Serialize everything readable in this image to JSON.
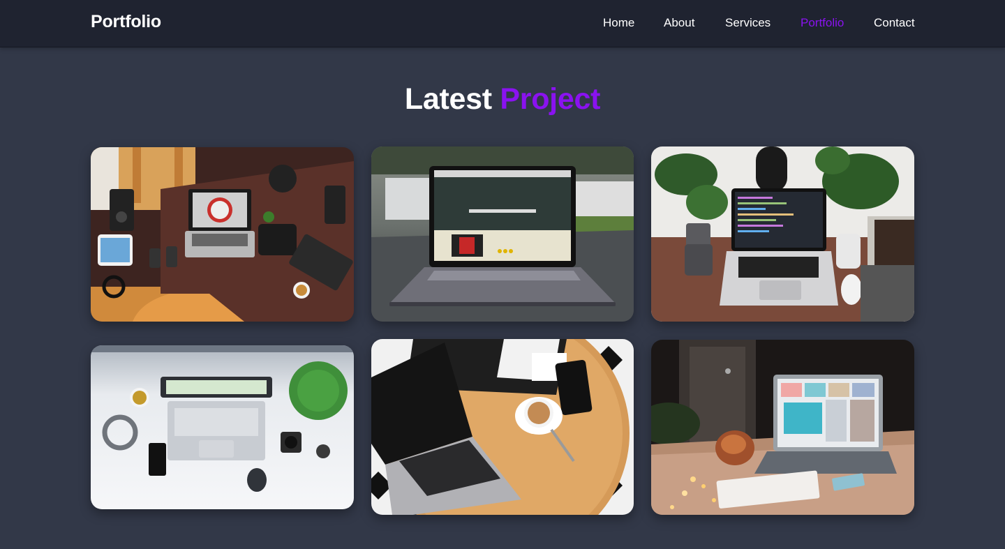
{
  "nav": {
    "brand": "Portfolio",
    "links": [
      {
        "label": "Home",
        "active": false
      },
      {
        "label": "About",
        "active": false
      },
      {
        "label": "Services",
        "active": false
      },
      {
        "label": "Portfolio",
        "active": true
      },
      {
        "label": "Contact",
        "active": false
      }
    ]
  },
  "section": {
    "title_main": "Latest",
    "title_accent": "Project"
  },
  "colors": {
    "page_background": "#323848",
    "navbar_background": "#1f2330",
    "accent": "#8a12f0",
    "text": "#ffffff"
  },
  "projects": [
    {
      "image": "desk-workspace-top-view-photo"
    },
    {
      "image": "laptop-on-glass-table-photo"
    },
    {
      "image": "laptop-with-code-and-plants-photo"
    },
    {
      "image": "white-desk-laptop-flatlay-photo"
    },
    {
      "image": "laptop-coffee-round-table-photo"
    },
    {
      "image": "laptop-with-lights-on-table-photo"
    }
  ]
}
